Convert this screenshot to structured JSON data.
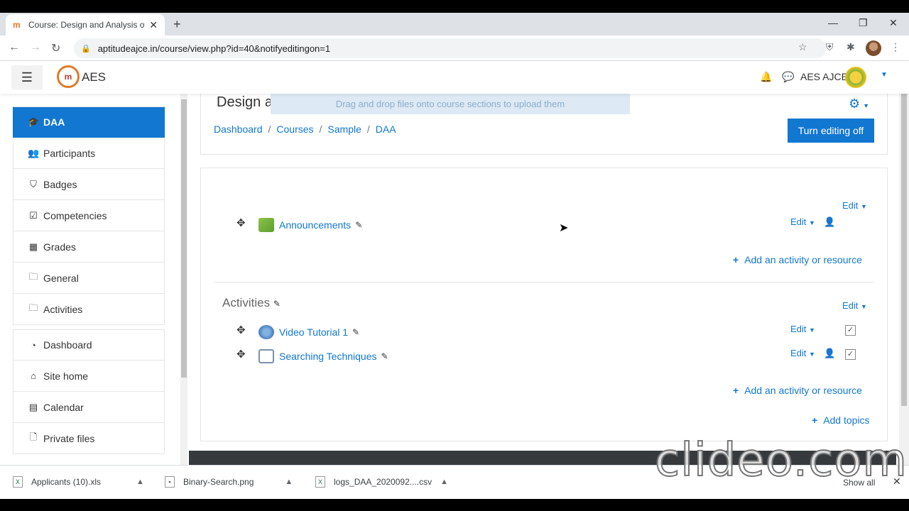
{
  "browser": {
    "tab_title": "Course: Design and Analysis of A",
    "url": "aptitudeajce.in/course/view.php?id=40&notifyeditingon=1"
  },
  "navbar": {
    "brand": "AES",
    "user_name": "AES AJCE"
  },
  "drawer": {
    "items": [
      {
        "label": "DAA",
        "icon": "graduation-cap-icon",
        "active": true
      },
      {
        "label": "Participants",
        "icon": "users-icon"
      },
      {
        "label": "Badges",
        "icon": "shield-icon"
      },
      {
        "label": "Competencies",
        "icon": "check-square-icon"
      },
      {
        "label": "Grades",
        "icon": "table-icon"
      },
      {
        "label": "General",
        "icon": "folder-icon"
      },
      {
        "label": "Activities",
        "icon": "folder-icon"
      },
      {
        "label": "Dashboard",
        "icon": "dashboard-icon"
      },
      {
        "label": "Site home",
        "icon": "home-icon"
      },
      {
        "label": "Calendar",
        "icon": "calendar-icon"
      },
      {
        "label": "Private files",
        "icon": "file-icon"
      }
    ]
  },
  "header": {
    "course_title": "Design a",
    "drop_message": "Drag and drop files onto course sections to upload them",
    "breadcrumb": [
      "Dashboard",
      "Courses",
      "Sample",
      "DAA"
    ],
    "turn_editing_off": "Turn editing off"
  },
  "sections": {
    "general": {
      "edit": "Edit",
      "activities": [
        {
          "name": "Announcements",
          "edit": "Edit",
          "icon": "forum-icon"
        }
      ],
      "add_activity": "Add an activity or resource"
    },
    "activities": {
      "name": "Activities",
      "edit": "Edit",
      "activities": [
        {
          "name": "Video Tutorial 1",
          "edit": "Edit",
          "icon": "url-globe-icon"
        },
        {
          "name": "Searching Techniques",
          "edit": "Edit",
          "icon": "page-icon"
        }
      ],
      "add_activity": "Add an activity or resource"
    },
    "add_topics": "Add topics"
  },
  "downloads": {
    "items": [
      "Applicants (10).xls",
      "Binary-Search.png",
      "logs_DAA_2020092....csv"
    ],
    "show_all": "Show all"
  },
  "watermark": "clideo.com",
  "colors": {
    "accent": "#1177d1",
    "drawer_active": "#1177d1"
  }
}
